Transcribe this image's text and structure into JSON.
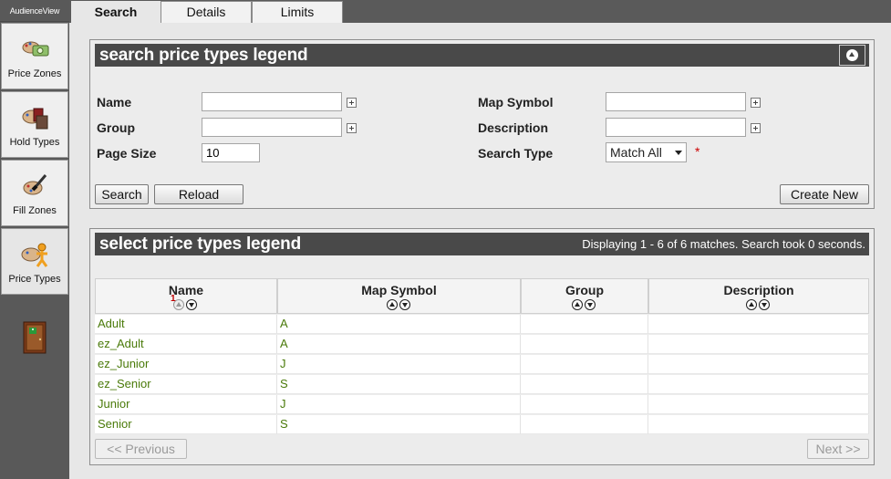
{
  "brand": "AudienceView",
  "sidebar": {
    "items": [
      {
        "label": "Price Zones",
        "icon": "price-zones-icon"
      },
      {
        "label": "Hold Types",
        "icon": "hold-types-icon"
      },
      {
        "label": "Fill Zones",
        "icon": "fill-zones-icon"
      },
      {
        "label": "Price Types",
        "icon": "price-types-icon",
        "active": true
      }
    ],
    "exit_icon": "exit-door-icon"
  },
  "tabs": [
    {
      "label": "Search",
      "active": true
    },
    {
      "label": "Details"
    },
    {
      "label": "Limits"
    }
  ],
  "search_panel": {
    "title": "search price types legend",
    "fields": {
      "name_label": "Name",
      "name_value": "",
      "group_label": "Group",
      "group_value": "",
      "page_size_label": "Page Size",
      "page_size_value": "10",
      "map_symbol_label": "Map Symbol",
      "map_symbol_value": "",
      "description_label": "Description",
      "description_value": "",
      "search_type_label": "Search Type",
      "search_type_value": "Match All",
      "required_marker": "*"
    },
    "buttons": {
      "search": "Search",
      "reload": "Reload",
      "create_new": "Create New"
    }
  },
  "results_panel": {
    "title": "select price types legend",
    "status": "Displaying 1 - 6 of 6 matches. Search took 0 seconds.",
    "columns": [
      "Name",
      "Map Symbol",
      "Group",
      "Description"
    ],
    "sort_rank": "1",
    "rows": [
      {
        "name": "Adult",
        "map_symbol": "A",
        "group": "",
        "description": ""
      },
      {
        "name": "ez_Adult",
        "map_symbol": "A",
        "group": "",
        "description": ""
      },
      {
        "name": "ez_Junior",
        "map_symbol": "J",
        "group": "",
        "description": ""
      },
      {
        "name": "ez_Senior",
        "map_symbol": "S",
        "group": "",
        "description": ""
      },
      {
        "name": "Junior",
        "map_symbol": "J",
        "group": "",
        "description": ""
      },
      {
        "name": "Senior",
        "map_symbol": "S",
        "group": "",
        "description": ""
      }
    ],
    "pagination": {
      "previous": "<< Previous",
      "next": "Next >>"
    }
  },
  "colors": {
    "header_bg": "#494949",
    "link_green": "#4a7a0a",
    "required_red": "#cc0000"
  }
}
